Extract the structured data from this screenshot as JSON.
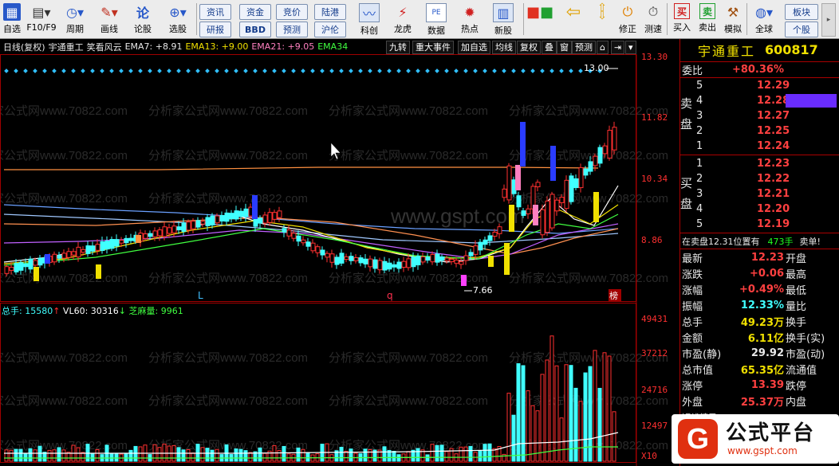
{
  "toolbar": {
    "items": [
      {
        "label": "自选",
        "icon": "star-icon"
      },
      {
        "label": "F10/F9",
        "icon": "document-icon"
      },
      {
        "label": "周期",
        "icon": "clock-icon"
      },
      {
        "label": "画线",
        "icon": "pencil-icon"
      },
      {
        "label": "论股",
        "icon": "discuss-icon"
      },
      {
        "label": "选股",
        "icon": "magnifier-icon"
      },
      {
        "label": "科创",
        "icon": "chart-icon"
      },
      {
        "label": "龙虎",
        "icon": "dragon-icon"
      },
      {
        "label": "数据",
        "icon": "pe-icon"
      },
      {
        "label": "热点",
        "icon": "hot-icon"
      },
      {
        "label": "新股",
        "icon": "newstock-icon"
      },
      {
        "label": "修正",
        "icon": "correct-icon"
      },
      {
        "label": "测速",
        "icon": "speed-icon"
      },
      {
        "label": "买入",
        "icon": "buy-icon"
      },
      {
        "label": "卖出",
        "icon": "sell-icon"
      },
      {
        "label": "模拟",
        "icon": "hammer-icon"
      },
      {
        "label": "全球",
        "icon": "globe-icon"
      }
    ],
    "small_buttons_top": [
      "资讯",
      "资金",
      "竞价",
      "陆港"
    ],
    "small_buttons_bottom": [
      "研报",
      "BBD",
      "预测",
      "沪伦"
    ],
    "right_buttons_top": "板块",
    "right_buttons_bottom": "个股"
  },
  "info_bar": {
    "period": "日线(复权)",
    "stock": "宇通重工",
    "strategy": "笑看风云",
    "ema7": "EMA7: +8.91",
    "ema13": "EMA13: +9.00",
    "ema21": "EMA21: +9.05",
    "ema34": "EMA34"
  },
  "chart_tabs": [
    "九转",
    "重大事件",
    "加自选",
    "均线",
    "复权",
    "叠",
    "窗",
    "预测"
  ],
  "price_axis": [
    "13.30",
    "11.82",
    "10.34",
    "8.86"
  ],
  "volume_axis": [
    "49431",
    "37212",
    "24716",
    "12497",
    "X10"
  ],
  "chart_annotations": {
    "high": "13.00",
    "low": "7.66",
    "marker_l": "L",
    "marker_q": "q",
    "marker_bang": "榜"
  },
  "volume_info": {
    "total": "总手: 15580",
    "vl60": "VL60: 30316",
    "zhima": "芝麻量: 9961"
  },
  "watermark": "分析家公式网www.70822.com",
  "watermark_center": "www.gspt.com",
  "quote": {
    "stock_name": "宇通重工",
    "stock_code": "600817",
    "weibi_label": "委比",
    "weibi_value": "+80.36%",
    "sell_label": "卖盘",
    "buy_label": "买盘",
    "sell": [
      {
        "level": "5",
        "price": "12.29"
      },
      {
        "level": "4",
        "price": "12.28"
      },
      {
        "level": "3",
        "price": "12.27"
      },
      {
        "level": "2",
        "price": "12.25"
      },
      {
        "level": "1",
        "price": "12.24"
      }
    ],
    "buy": [
      {
        "level": "1",
        "price": "12.23"
      },
      {
        "level": "2",
        "price": "12.22"
      },
      {
        "level": "3",
        "price": "12.21"
      },
      {
        "level": "4",
        "price": "12.20"
      },
      {
        "level": "5",
        "price": "12.19"
      }
    ],
    "notice": "在卖盘12.31位置有",
    "notice_vol": "473手",
    "notice_tag": "卖单!",
    "stats": [
      {
        "label": "最新",
        "value": "12.23",
        "label2": "开盘"
      },
      {
        "label": "涨跌",
        "value": "+0.06",
        "label2": "最高"
      },
      {
        "label": "涨幅",
        "value": "+0.49%",
        "label2": "最低"
      },
      {
        "label": "振幅",
        "value": "12.33%",
        "label2": "量比"
      },
      {
        "label": "总手",
        "value": "49.23万",
        "label2": "换手"
      },
      {
        "label": "金额",
        "value": "6.11亿",
        "label2": "换手(实)"
      },
      {
        "label": "市盈(静)",
        "value": "29.92",
        "label2": "市盈(动)"
      },
      {
        "label": "总市值",
        "value": "65.35亿",
        "label2": "流通值"
      },
      {
        "label": "涨停",
        "value": "13.39",
        "label2": "跌停"
      },
      {
        "label": "外盘",
        "value": "25.37万",
        "label2": "内盘"
      }
    ],
    "footer": "短线精灵"
  },
  "logo": {
    "text": "公式平台",
    "url": "www.gspt.com"
  },
  "colors": {
    "up": "#ff3030",
    "down": "#40ffff",
    "accent_blue": "#2a3cff",
    "accent_yellow": "#f0e000",
    "accent_pink": "#ff80c0"
  }
}
